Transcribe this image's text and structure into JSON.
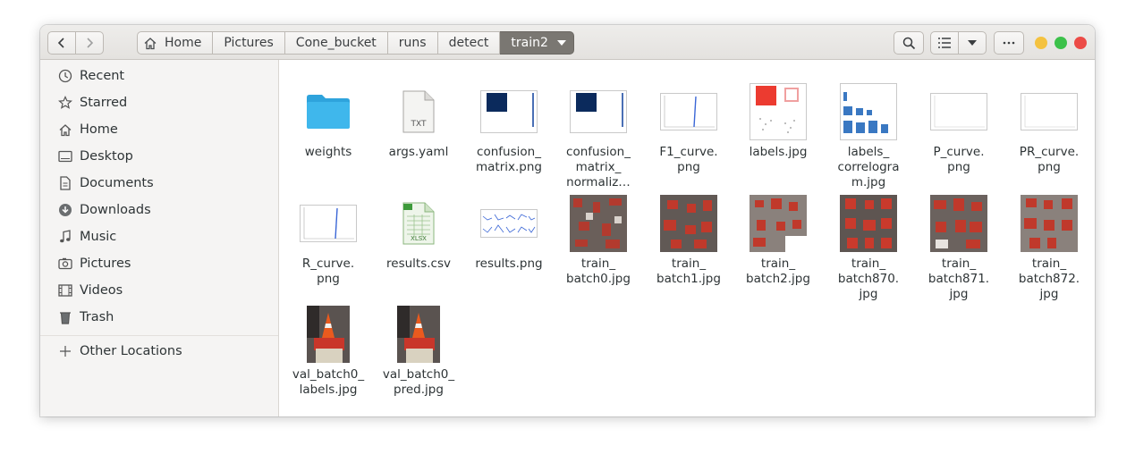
{
  "breadcrumb": [
    "Home",
    "Pictures",
    "Cone_bucket",
    "runs",
    "detect",
    "train2"
  ],
  "sidebar": {
    "items": [
      {
        "label": "Recent",
        "icon": "clock-icon"
      },
      {
        "label": "Starred",
        "icon": "star-icon"
      },
      {
        "label": "Home",
        "icon": "home-icon"
      },
      {
        "label": "Desktop",
        "icon": "desktop-icon"
      },
      {
        "label": "Documents",
        "icon": "documents-icon"
      },
      {
        "label": "Downloads",
        "icon": "downloads-icon"
      },
      {
        "label": "Music",
        "icon": "music-icon"
      },
      {
        "label": "Pictures",
        "icon": "pictures-icon"
      },
      {
        "label": "Videos",
        "icon": "videos-icon"
      },
      {
        "label": "Trash",
        "icon": "trash-icon"
      }
    ],
    "other_locations": "Other Locations"
  },
  "files": [
    {
      "name": "weights",
      "kind": "folder"
    },
    {
      "name": "args.yaml",
      "kind": "text",
      "badge": "TXT"
    },
    {
      "name": "confusion_\nmatrix.png",
      "kind": "confusion"
    },
    {
      "name": "confusion_\nmatrix_\nnormaliz…",
      "kind": "confusion"
    },
    {
      "name": "F1_curve.\npng",
      "kind": "curve"
    },
    {
      "name": "labels.jpg",
      "kind": "labels"
    },
    {
      "name": "labels_\ncorrelogra\nm.jpg",
      "kind": "correlogram"
    },
    {
      "name": "P_curve.\npng",
      "kind": "curve-flat"
    },
    {
      "name": "PR_curve.\npng",
      "kind": "curve-flat"
    },
    {
      "name": "R_curve.\npng",
      "kind": "curve"
    },
    {
      "name": "results.csv",
      "kind": "spreadsheet",
      "badge": "XLSX"
    },
    {
      "name": "results.png",
      "kind": "results"
    },
    {
      "name": "train_\nbatch0.jpg",
      "kind": "batch"
    },
    {
      "name": "train_\nbatch1.jpg",
      "kind": "batch"
    },
    {
      "name": "train_\nbatch2.jpg",
      "kind": "batch"
    },
    {
      "name": "train_\nbatch870.\njpg",
      "kind": "batch"
    },
    {
      "name": "train_\nbatch871.\njpg",
      "kind": "batch"
    },
    {
      "name": "train_\nbatch872.\njpg",
      "kind": "batch"
    },
    {
      "name": "val_batch0_\nlabels.jpg",
      "kind": "val"
    },
    {
      "name": "val_batch0_\npred.jpg",
      "kind": "val"
    }
  ],
  "colors": {
    "folder": "#3fb7ec",
    "accent_red": "#ec4b46",
    "confusion_navy": "#0b2a5c",
    "curve_blue": "#3a66d6"
  }
}
